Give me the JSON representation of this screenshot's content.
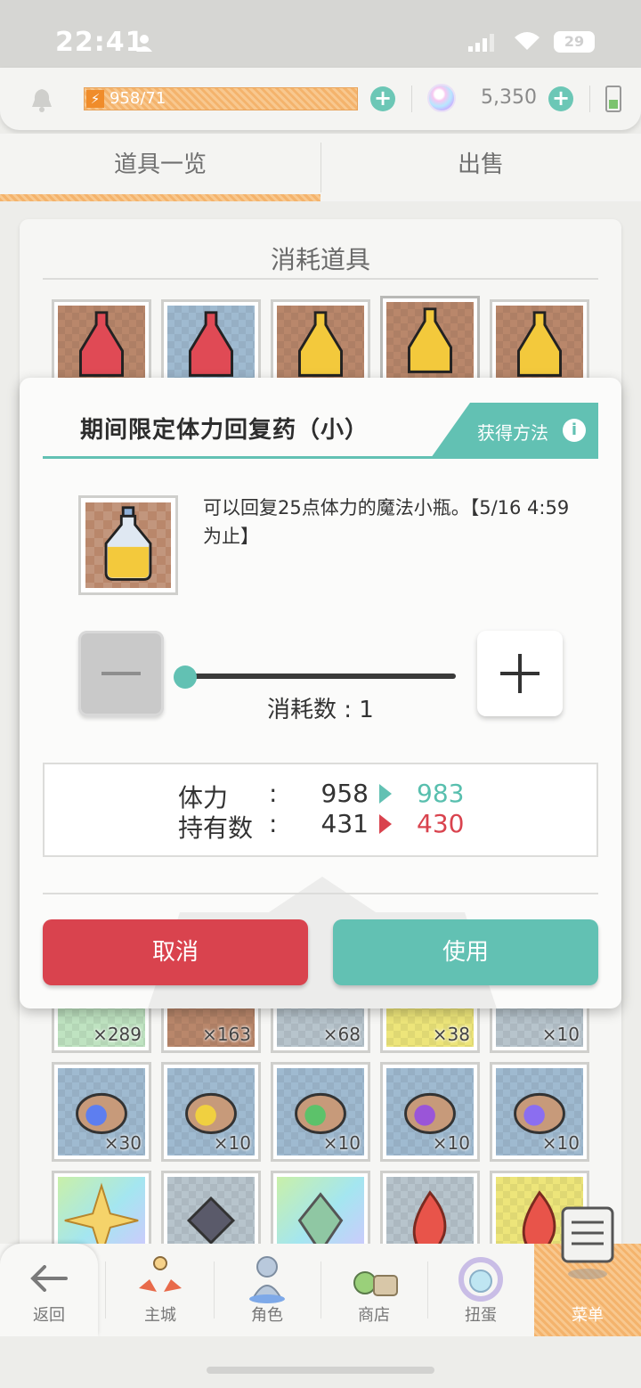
{
  "status_bar": {
    "time": "22:41",
    "battery": "29"
  },
  "resources": {
    "stamina": "958/71",
    "gems": "5,350"
  },
  "tabs": [
    {
      "label": "道具一览",
      "active": true
    },
    {
      "label": "出售",
      "active": false
    }
  ],
  "inventory": {
    "section_title": "消耗道具",
    "row_counts_bottom": [
      "×289",
      "×163",
      "×68",
      "×38",
      "×10"
    ],
    "row2_counts": [
      "×30",
      "×10",
      "×10",
      "×10",
      "×10"
    ]
  },
  "modal": {
    "title": "期间限定体力回复药（小）",
    "obtain_label": "获得方法",
    "description": "可以回复25点体力的魔法小瓶。【5/16 4:59 为止】",
    "consume_label": "消耗数 : 1",
    "consume_value": 1,
    "slider_fraction": 0,
    "stats": [
      {
        "label": "体力",
        "colon": ":",
        "from": "958",
        "to": "983"
      },
      {
        "label": "持有数",
        "colon": ":",
        "from": "431",
        "to": "430"
      }
    ],
    "cancel_label": "取消",
    "use_label": "使用"
  },
  "bottom_nav": {
    "back_label": "返回",
    "items": [
      {
        "label": "主城",
        "icon": "castle-icon"
      },
      {
        "label": "角色",
        "icon": "character-icon"
      },
      {
        "label": "商店",
        "icon": "shop-icon"
      },
      {
        "label": "扭蛋",
        "icon": "gacha-icon"
      },
      {
        "label": "菜单",
        "icon": "menu-icon",
        "active": true
      }
    ]
  },
  "colors": {
    "accent_teal": "#62c1b3",
    "danger_red": "#d9434e",
    "stamina_orange": "#f4b36c"
  }
}
